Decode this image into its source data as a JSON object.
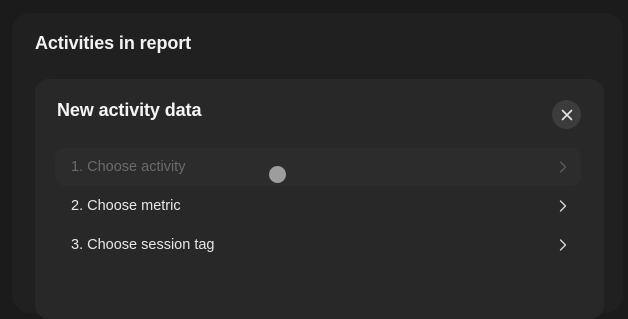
{
  "outer": {
    "title": "Activities in report"
  },
  "panel": {
    "title": "New activity data",
    "close_icon": "close-icon"
  },
  "steps": [
    {
      "label": "1. Choose activity",
      "state": "active",
      "icon": "chevron-right-icon"
    },
    {
      "label": "2. Choose metric",
      "state": "default",
      "icon": "chevron-right-icon"
    },
    {
      "label": "3. Choose session tag",
      "state": "default",
      "icon": "chevron-right-icon"
    }
  ],
  "colors": {
    "page_bg": "#1b1b1b",
    "card_bg": "#202020",
    "panel_bg": "#282828",
    "close_bg": "#3c3c3c",
    "text_primary": "#f2f2f2",
    "text_muted": "#6a6a6a",
    "cursor": "#9d9d9d"
  }
}
